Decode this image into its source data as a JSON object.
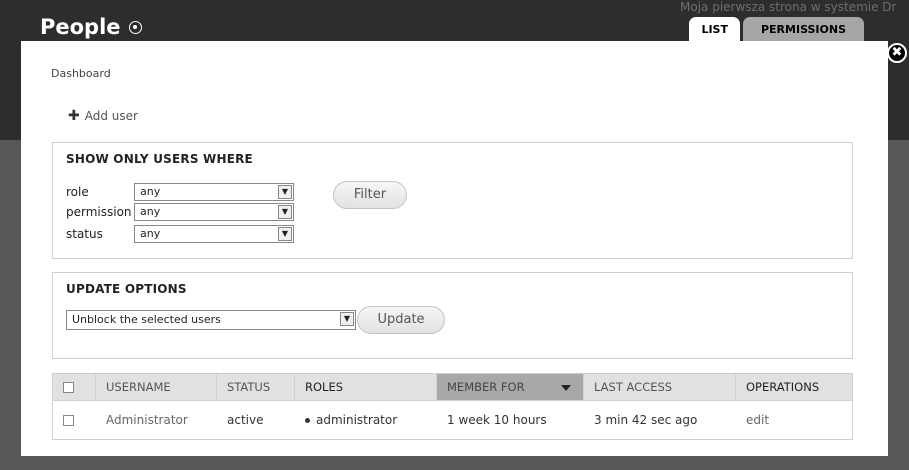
{
  "overlay": {
    "title": "People",
    "tabs": [
      {
        "label": "LIST",
        "active": true
      },
      {
        "label": "PERMISSIONS",
        "active": false
      }
    ],
    "close_glyph": "✖"
  },
  "background": {
    "top_text": "Moja pierwsza strona w systemie Dr"
  },
  "breadcrumb": "Dashboard",
  "add_user": {
    "icon": "plus-icon",
    "label": "Add user"
  },
  "filters": {
    "title": "SHOW ONLY USERS WHERE",
    "rows": [
      {
        "label": "role",
        "value": "any"
      },
      {
        "label": "permission",
        "value": "any"
      },
      {
        "label": "status",
        "value": "any"
      }
    ],
    "button": "Filter"
  },
  "update": {
    "title": "UPDATE OPTIONS",
    "select_value": "Unblock the selected users",
    "button": "Update"
  },
  "table": {
    "columns": [
      "USERNAME",
      "STATUS",
      "ROLES",
      "MEMBER FOR",
      "LAST ACCESS",
      "OPERATIONS"
    ],
    "sorted_column": "MEMBER FOR",
    "rows": [
      {
        "username": "Administrator",
        "status": "active",
        "roles": "administrator",
        "member_for": "1 week 10 hours",
        "last_access": "3 min 42 sec ago",
        "operation": "edit"
      }
    ]
  },
  "colors": {
    "tab_active": "#ffffff",
    "tab_inactive": "#a6a6a6",
    "sorted_header": "#a8a8a8",
    "header_bg": "#e1e1e1"
  }
}
